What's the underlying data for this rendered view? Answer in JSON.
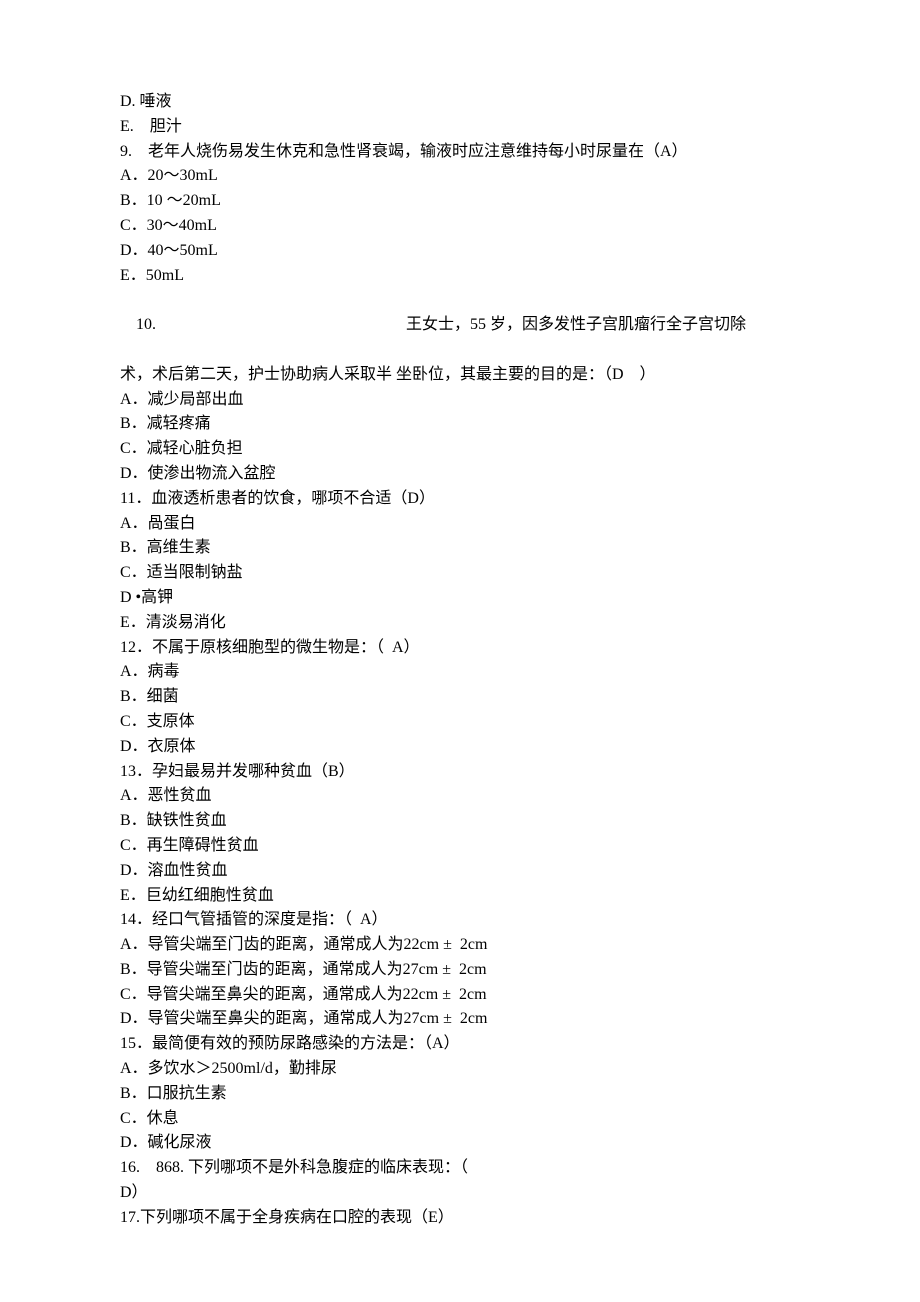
{
  "lines": {
    "l1": "D. 唾液",
    "l2": "E.    胆汁",
    "l3": "9.    老年人烧伤易发生休克和急性肾衰竭，输液时应注意维持每小时尿量在（A）",
    "l4": "A．20〜30mL",
    "l5": "B．10 〜20mL",
    "l6": "C．30〜40mL",
    "l7": "D．40〜50mL",
    "l8": "E．50mL",
    "l9num": "10.",
    "l9rest": "王女士，55 岁，因多发性子宫肌瘤行全子宫切除",
    "l10": "术，术后第二天，护士协助病人采取半 坐卧位，其最主要的目的是：（D    ）",
    "l11": "A．减少局部出血",
    "l12": "B．减轻疼痛",
    "l13": "C．减轻心脏负担",
    "l14": "D．使渗出物流入盆腔",
    "l15": "11．血液透析患者的饮食，哪项不合适（D）",
    "l16": "A．咼蛋白",
    "l17": "B．高维生素",
    "l18": "C．适当限制钠盐",
    "l19": "D •高钾",
    "l20": "E．清淡易消化",
    "l21": "12．不属于原核细胞型的微生物是：（  A）",
    "l22": "A．病毒",
    "l23": "B．细菌",
    "l24": "C．支原体",
    "l25": "D．衣原体",
    "l26": "13．孕妇最易并发哪种贫血（B）",
    "l27": "A．恶性贫血",
    "l28": "B．缺铁性贫血",
    "l29": "C．再生障碍性贫血",
    "l30": "D．溶血性贫血",
    "l31": "E．巨幼红细胞性贫血",
    "l32": "14．经口气管插管的深度是指：（  A）",
    "l33": "A．导管尖端至门齿的距离，通常成人为22cm ±  2cm",
    "l34": "B．导管尖端至门齿的距离，通常成人为27cm ±  2cm",
    "l35": "C．导管尖端至鼻尖的距离，通常成人为22cm ±  2cm",
    "l36": "D．导管尖端至鼻尖的距离，通常成人为27cm ±  2cm",
    "l37": "15．最简便有效的预防尿路感染的方法是：（A）",
    "l38": "A．多饮水＞2500ml/d，勤排尿",
    "l39": "B．口服抗生素",
    "l40": "C．休息",
    "l41": "D．碱化尿液",
    "l42": "16.    868. 下列哪项不是外科急腹症的临床表现：（",
    "l43": "D）",
    "l44": "17.下列哪项不属于全身疾病在口腔的表现（E）"
  }
}
